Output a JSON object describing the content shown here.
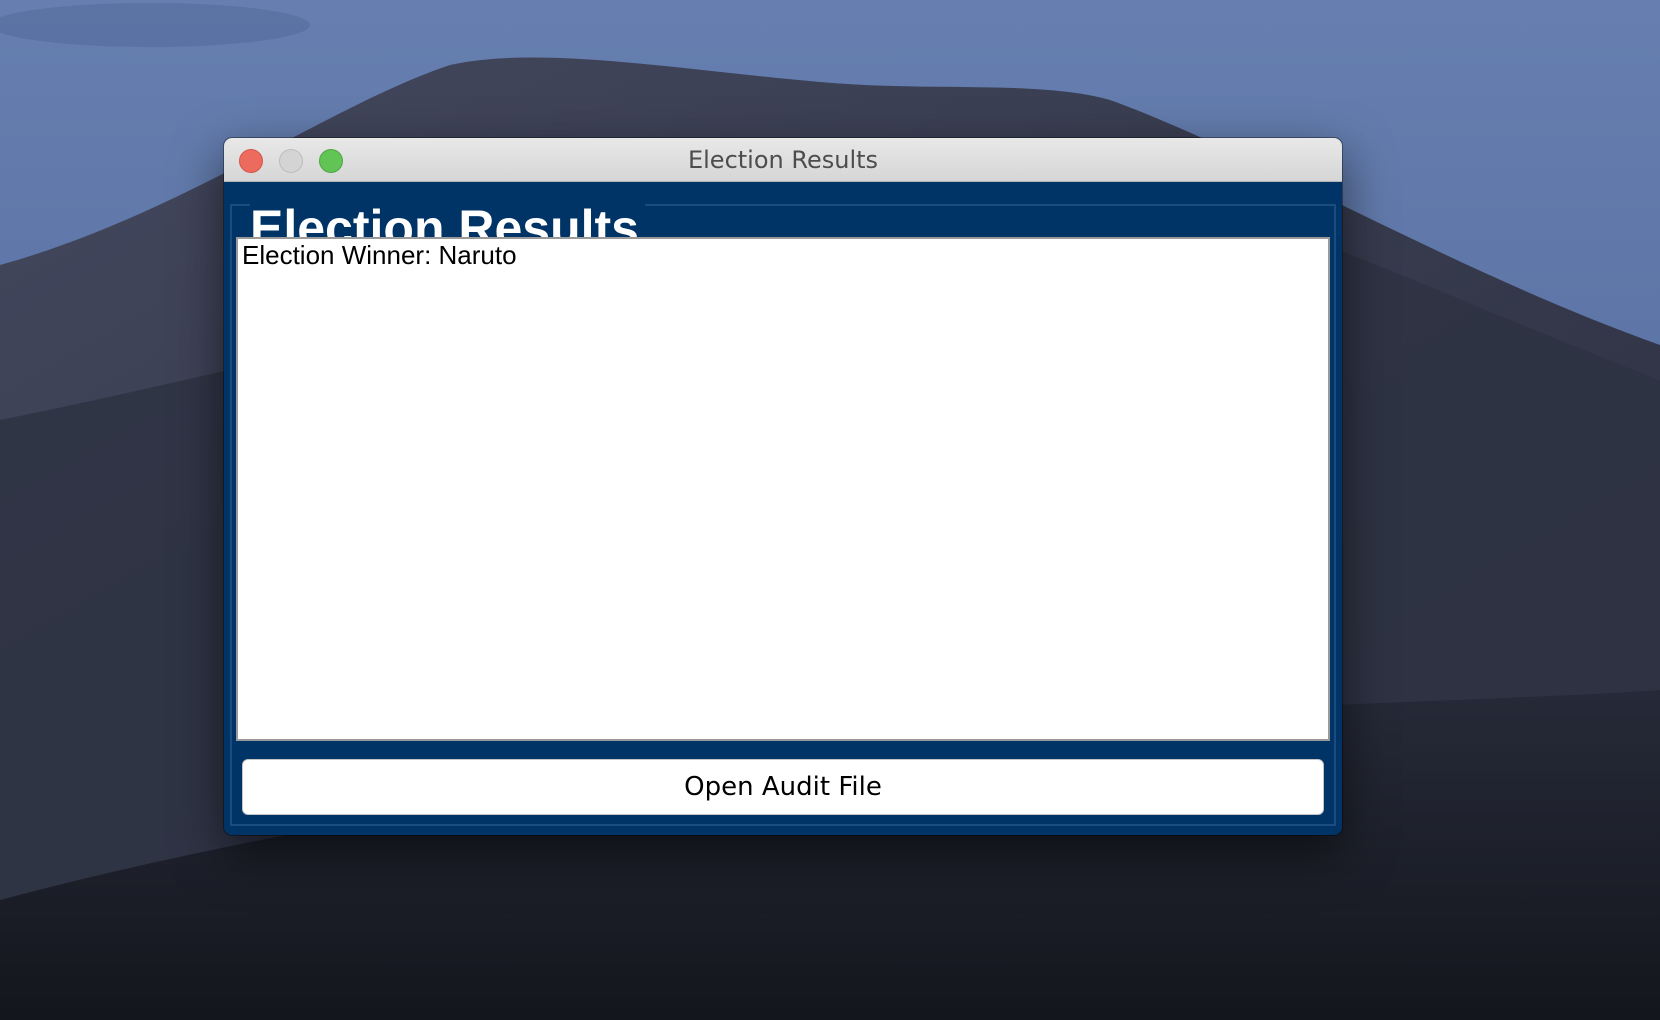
{
  "window": {
    "title": "Election Results"
  },
  "panel": {
    "heading": "Election Results"
  },
  "results": {
    "text": "Election Winner: Naruto"
  },
  "actions": {
    "open_audit_label": "Open Audit File"
  },
  "colors": {
    "panel_background": "#003366",
    "traffic_close": "#ed6a5e",
    "traffic_minimize": "#d4d4d4",
    "traffic_zoom": "#61c454"
  }
}
